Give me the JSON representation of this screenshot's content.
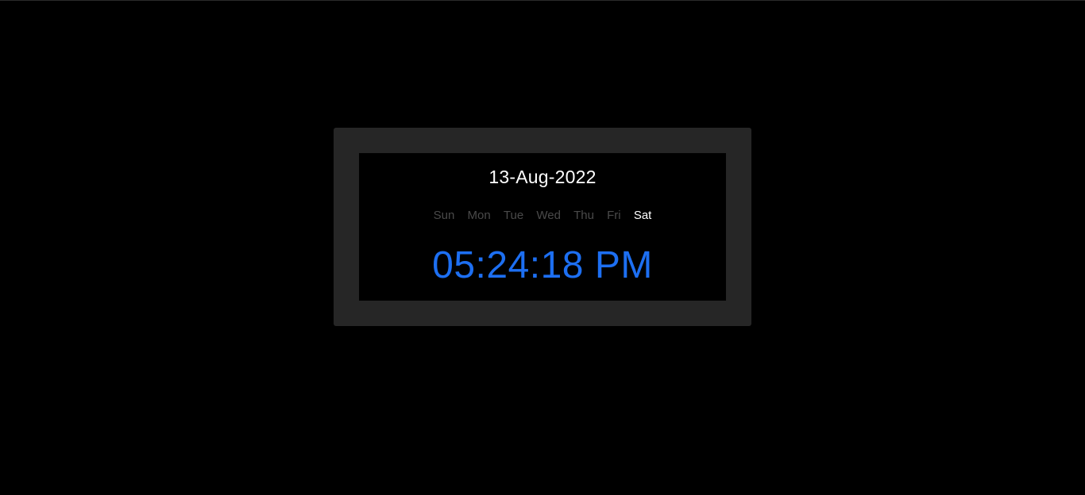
{
  "clock": {
    "date": "13-Aug-2022",
    "days": [
      {
        "label": "Sun",
        "active": false
      },
      {
        "label": "Mon",
        "active": false
      },
      {
        "label": "Tue",
        "active": false
      },
      {
        "label": "Wed",
        "active": false
      },
      {
        "label": "Thu",
        "active": false
      },
      {
        "label": "Fri",
        "active": false
      },
      {
        "label": "Sat",
        "active": true
      }
    ],
    "time": "05:24:18 PM",
    "colors": {
      "time": "#1d6ff2",
      "inactive_day": "#4a4a4a",
      "active_day": "#ffffff",
      "frame": "#262626",
      "background": "#000000"
    }
  }
}
